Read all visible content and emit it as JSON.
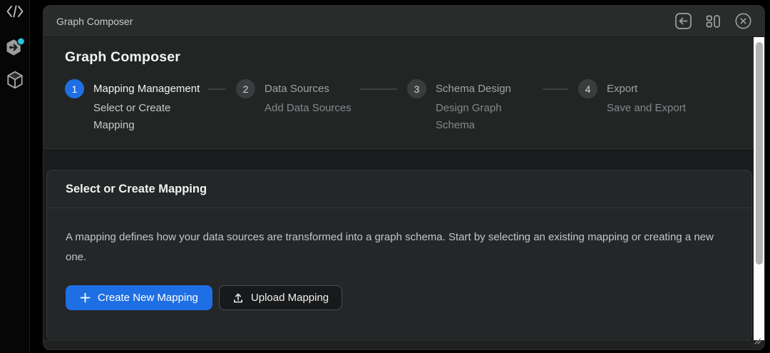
{
  "sidebar": {
    "icons": [
      {
        "name": "code-icon"
      },
      {
        "name": "plugin-icon",
        "badge": true,
        "badge_color": "#2bc1da"
      },
      {
        "name": "cube-icon"
      }
    ]
  },
  "window": {
    "titlebar": {
      "title": "Graph Composer",
      "actions": [
        "back-icon",
        "panel-layout-icon",
        "close-icon"
      ]
    },
    "heading": "Graph Composer",
    "stepper": [
      {
        "number": "1",
        "label": "Mapping Management",
        "sublabel": "Select or Create Mapping",
        "state": "active"
      },
      {
        "number": "2",
        "label": "Data Sources",
        "sublabel": "Add Data Sources",
        "state": "upcoming"
      },
      {
        "number": "3",
        "label": "Schema Design",
        "sublabel": "Design Graph Schema",
        "state": "upcoming"
      },
      {
        "number": "4",
        "label": "Export",
        "sublabel": "Save and Export",
        "state": "upcoming"
      }
    ],
    "card": {
      "title": "Select or Create Mapping",
      "description": "A mapping defines how your data sources are transformed into a graph schema. Start by selecting an existing mapping or creating a new one.",
      "buttons": {
        "primary": {
          "label": "Create New Mapping",
          "icon": "plus-icon"
        },
        "secondary": {
          "label": "Upload Mapping",
          "icon": "upload-icon"
        }
      }
    }
  },
  "colors": {
    "accent_blue": "#1e6fe3",
    "badge_cyan": "#2bc1da",
    "scrollbar_track": "#fbfbfb",
    "scrollbar_thumb": "#b1b3b3"
  }
}
